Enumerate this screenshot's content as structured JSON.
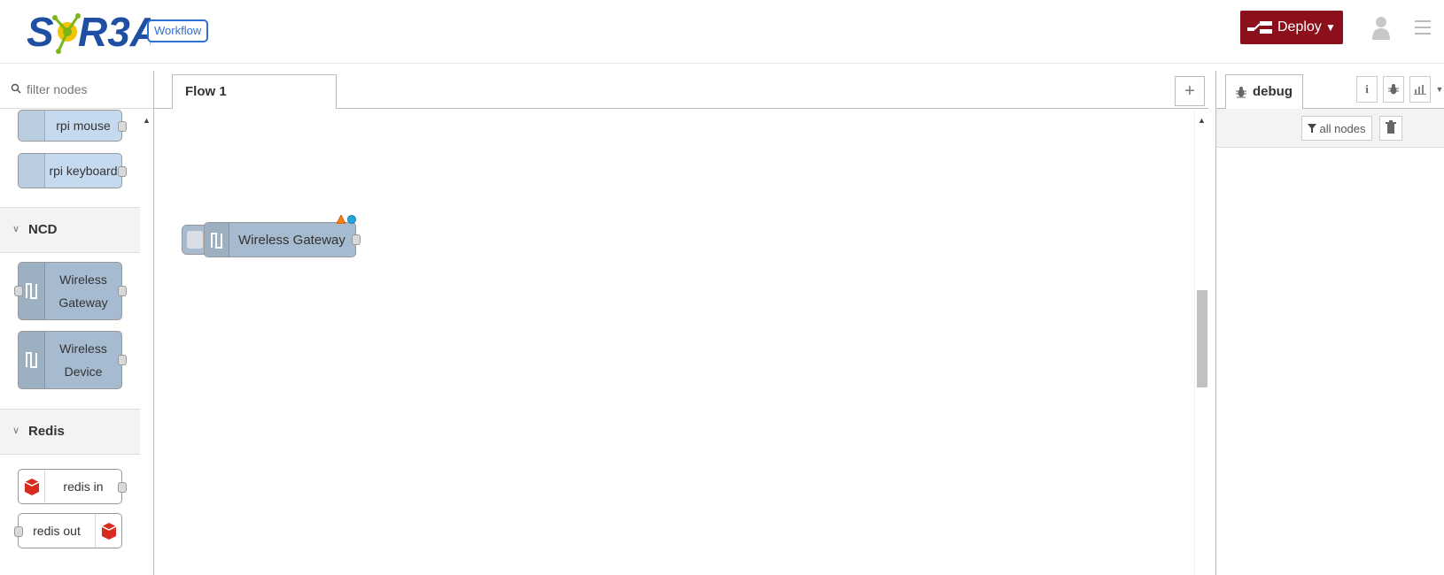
{
  "header": {
    "brand": "SORBA",
    "workflow_badge": "Workflow",
    "deploy_label": "Deploy",
    "accent_color": "#8c101c"
  },
  "palette": {
    "search_placeholder": "filter nodes",
    "rpi_nodes": [
      "rpi mouse",
      "rpi keyboard"
    ],
    "categories": [
      {
        "name": "NCD",
        "nodes": [
          "Wireless Gateway",
          "Wireless Device"
        ]
      },
      {
        "name": "Redis",
        "nodes": [
          "redis in",
          "redis out"
        ]
      }
    ]
  },
  "workspace": {
    "tabs": [
      {
        "label": "Flow 1"
      }
    ],
    "add_tab_label": "+",
    "nodes": [
      {
        "label": "Wireless Gateway",
        "color": "#a6bbcf"
      }
    ]
  },
  "sidebar": {
    "active_tab": "debug",
    "filter_label": "all nodes",
    "info_label": "i"
  },
  "icons": [
    "search-icon",
    "wave-icon",
    "raspberry-icon",
    "redis-icon",
    "bug-icon",
    "trash-icon",
    "user-icon",
    "menu-icon",
    "filter-icon",
    "chart-icon"
  ]
}
